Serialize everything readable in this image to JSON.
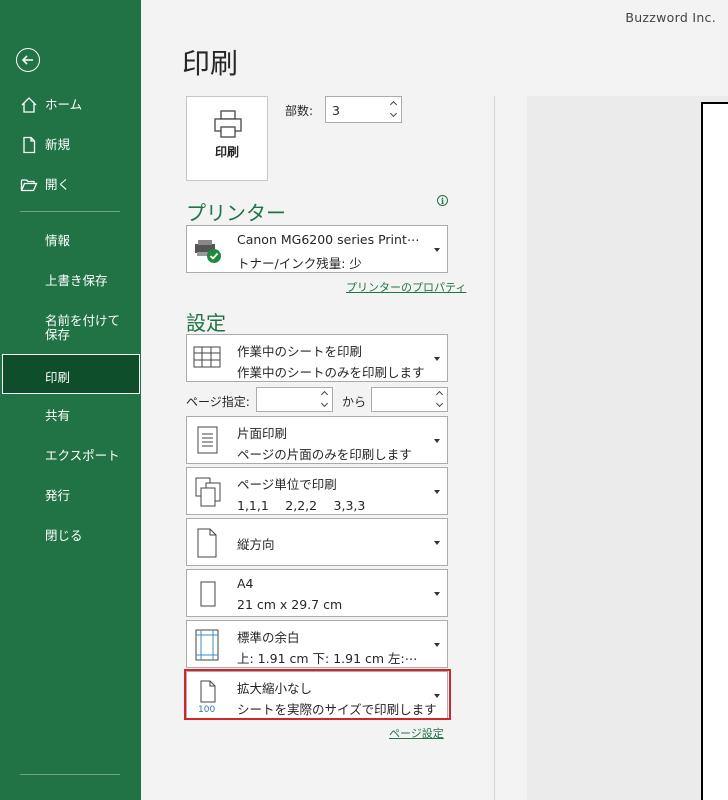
{
  "watermark": "Buzzword Inc.",
  "sidebar": {
    "home": "ホーム",
    "new": "新規",
    "open": "開く",
    "info": "情報",
    "overwrite_save": "上書き保存",
    "save_as": "名前を付けて保存",
    "print": "印刷",
    "share": "共有",
    "export": "エクスポート",
    "publish": "発行",
    "close": "閉じる",
    "colors": {
      "background": "#217346",
      "selected": "#0e4e2a"
    }
  },
  "page_title": "印刷",
  "print_button": {
    "label": "印刷"
  },
  "copies": {
    "label": "部数:",
    "value": "3"
  },
  "printer": {
    "heading": "プリンター",
    "name": "Canon MG6200 series Print⋯",
    "status": "トナー/インク残量: 少",
    "properties_link": "プリンターのプロパティ"
  },
  "settings": {
    "heading": "設定",
    "what_to_print": {
      "title": "作業中のシートを印刷",
      "desc": "作業中のシートのみを印刷します"
    },
    "pages": {
      "label": "ページ指定:",
      "from": "",
      "to_label": "から",
      "to": ""
    },
    "sides": {
      "title": "片面印刷",
      "desc": "ページの片面のみを印刷します"
    },
    "collation": {
      "title": "ページ単位で印刷",
      "desc": "1,1,1　 2,2,2　 3,3,3"
    },
    "orientation": {
      "title": "縦方向"
    },
    "paper": {
      "title": "A4",
      "desc": "21 cm x 29.7 cm"
    },
    "margins": {
      "title": "標準の余白",
      "desc": "上: 1.91 cm 下: 1.91 cm 左:⋯"
    },
    "scaling": {
      "title": "拡大縮小なし",
      "desc": "シートを実際のサイズで印刷します",
      "icon_text": "100"
    },
    "page_setup_link": "ページ設定"
  },
  "colors": {
    "accent": "#217346",
    "highlight": "#d3232b"
  }
}
